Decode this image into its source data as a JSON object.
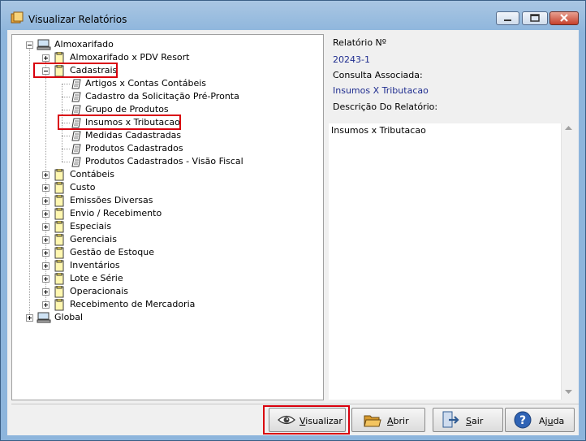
{
  "window": {
    "title": "Visualizar Relatórios"
  },
  "tree": {
    "root": "Almoxarifado",
    "level1": [
      "Almoxarifado x PDV Resort",
      "Cadastrais",
      "Contábeis",
      "Custo",
      "Emissões Diversas",
      "Envio / Recebimento",
      "Especiais",
      "Gerenciais",
      "Gestão de Estoque",
      "Inventários",
      "Lote e Série",
      "Operacionais",
      "Recebimento de Mercadoria"
    ],
    "cadastrais_children": [
      "Artigos x Contas Contábeis",
      "Cadastro da Solicitação Pré-Pronta",
      "Grupo de Produtos",
      "Insumos x Tributacao",
      "Medidas Cadastradas",
      "Produtos Cadastrados",
      "Produtos Cadastrados - Visão Fiscal"
    ],
    "global": "Global"
  },
  "info": {
    "relatorio_label": "Relatório Nº",
    "relatorio_value": "20243-1",
    "consulta_label": "Consulta Associada:",
    "consulta_value": "Insumos X Tributacao",
    "descricao_label": "Descrição Do Relatório:",
    "descricao_text": "Insumos x Tributacao"
  },
  "buttons": {
    "visualizar": {
      "pre": "",
      "key": "V",
      "post": "isualizar"
    },
    "abrir": {
      "pre": "",
      "key": "A",
      "post": "brir"
    },
    "sair": {
      "pre": "",
      "key": "S",
      "post": "air"
    },
    "ajuda": {
      "pre": "Aj",
      "key": "u",
      "post": "da"
    }
  },
  "icons": {
    "title": "reports-icon",
    "folder": "report-folder-icon",
    "report": "report-document-icon"
  },
  "colors": {
    "highlight": "#d9000d",
    "value_text": "#1f2d8f"
  }
}
